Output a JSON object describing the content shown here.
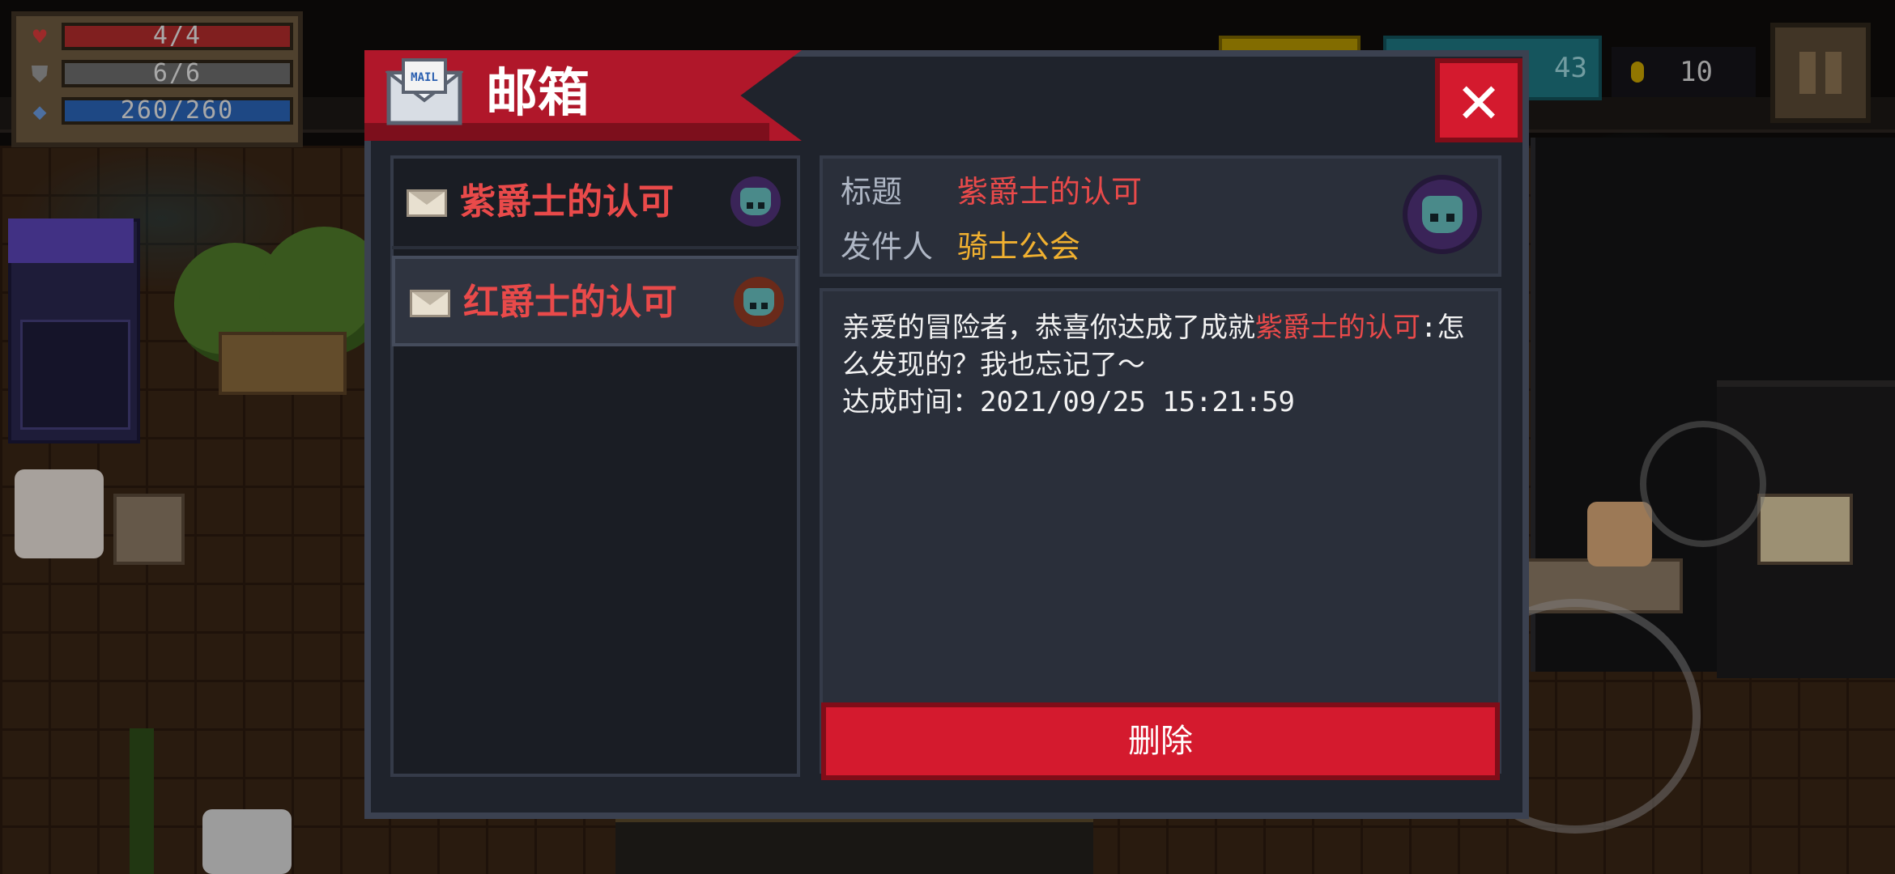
{
  "hud": {
    "hp": "4/4",
    "armor": "6/6",
    "energy": "260/260",
    "gems": "43",
    "coins": "10",
    "icons": [
      "heart-icon",
      "shield-icon",
      "diamond-icon"
    ]
  },
  "mailbox": {
    "title": "邮箱",
    "mail_icon_text": "MAIL",
    "close_symbol": "✕",
    "items": [
      {
        "title": "紫爵士的认可",
        "helm_color": "#3a2458"
      },
      {
        "title": "红爵士的认可",
        "helm_color": "#6a2a1a"
      }
    ],
    "detail": {
      "title_label": "标题",
      "title_value": "紫爵士的认可",
      "sender_label": "发件人",
      "sender_value": "骑士公会",
      "body_intro": "亲爱的冒险者，恭喜你达成了成就",
      "body_highlight": "紫爵士的认可",
      "body_rest": ":怎么发现的？我也忘记了～",
      "body_time_label": "达成时间：",
      "body_time_value": "2021/09/25 15:21:59"
    },
    "delete_label": "删除"
  },
  "colors": {
    "accent_red": "#d41a2e",
    "title_red": "#e94a4a",
    "sender_gold": "#f0b030",
    "panel": "#2a2f3a"
  }
}
